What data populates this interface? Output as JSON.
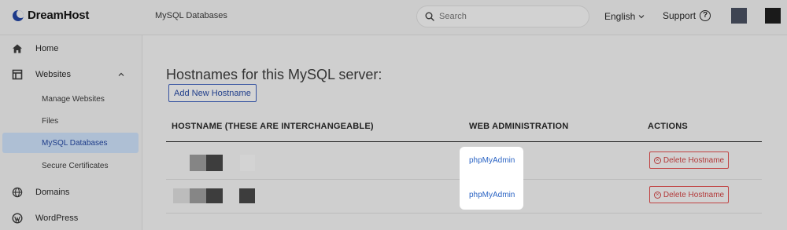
{
  "header": {
    "brand": "DreamHost",
    "breadcrumb": "MySQL Databases",
    "search_placeholder": "Search",
    "language": "English",
    "support": "Support",
    "help_symbol": "?"
  },
  "sidebar": {
    "items": [
      {
        "label": "Home",
        "icon": "home-icon"
      },
      {
        "label": "Websites",
        "icon": "websites-icon"
      },
      {
        "label": "Domains",
        "icon": "globe-icon"
      },
      {
        "label": "WordPress",
        "icon": "wordpress-icon"
      }
    ],
    "subitems": [
      {
        "label": "Manage Websites"
      },
      {
        "label": "Files"
      },
      {
        "label": "MySQL Databases",
        "active": true
      },
      {
        "label": "Secure Certificates"
      }
    ]
  },
  "main": {
    "title": "Hostnames for this MySQL server:",
    "add_button": "Add New Hostname",
    "columns": [
      "HOSTNAME (THESE ARE INTERCHANGEABLE)",
      "WEB ADMINISTRATION",
      "ACTIONS"
    ],
    "rows": [
      {
        "web_admin": "phpMyAdmin",
        "action": "Delete Hostname"
      },
      {
        "web_admin": "phpMyAdmin",
        "action": "Delete Hostname"
      }
    ]
  },
  "colors": {
    "accent": "#1f3d8a",
    "link": "#2b64c4",
    "danger": "#b23a3a",
    "active_nav": "#aebfd4"
  }
}
